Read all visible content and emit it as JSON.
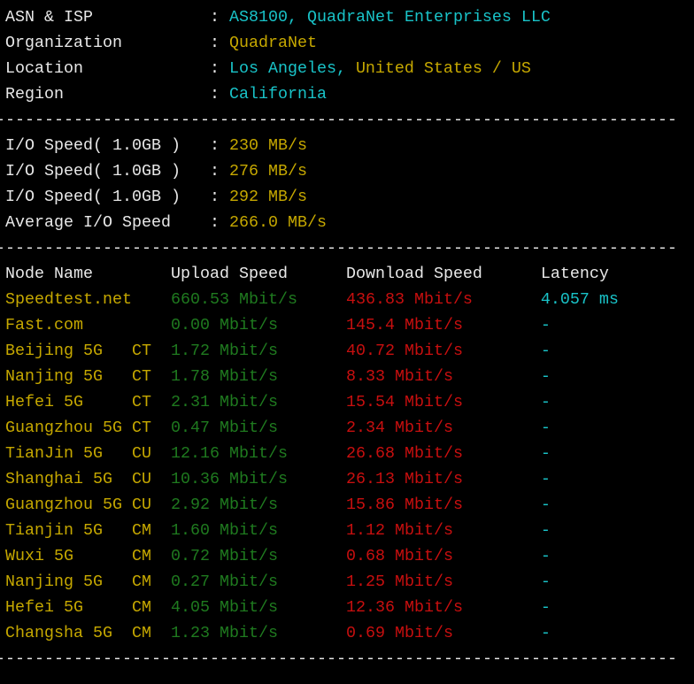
{
  "colors": {
    "white": "#e8e8e8",
    "cyan": "#19c3c8",
    "yellow": "#c6a800",
    "green": "#1f7a1f",
    "red": "#c80f0f"
  },
  "info": [
    {
      "label": "ASN & ISP",
      "value": "AS8100, QuadraNet Enterprises LLC",
      "value2": ""
    },
    {
      "label": "Organization",
      "value": "QuadraNet",
      "value2": ""
    },
    {
      "label": "Location",
      "value": "Los Angeles,",
      "value2": "United States / US"
    },
    {
      "label": "Region",
      "value": "California",
      "value2": ""
    }
  ],
  "separator": "----------------------------------------------------------------------",
  "io": [
    {
      "label": "I/O Speed( 1.0GB )",
      "value": "230 MB/s"
    },
    {
      "label": "I/O Speed( 1.0GB )",
      "value": "276 MB/s"
    },
    {
      "label": "I/O Speed( 1.0GB )",
      "value": "292 MB/s"
    },
    {
      "label": "Average I/O Speed",
      "value": "266.0 MB/s"
    }
  ],
  "speed_headers": {
    "node": "Node Name",
    "upload": "Upload Speed",
    "download": "Download Speed",
    "latency": "Latency"
  },
  "speed_rows": [
    {
      "node": "Speedtest.net",
      "isp": "",
      "upload": "660.53 Mbit/s",
      "download": "436.83 Mbit/s",
      "latency": "4.057 ms"
    },
    {
      "node": "Fast.com",
      "isp": "",
      "upload": "0.00 Mbit/s",
      "download": "145.4 Mbit/s",
      "latency": "-"
    },
    {
      "node": "Beijing 5G",
      "isp": "CT",
      "upload": "1.72 Mbit/s",
      "download": "40.72 Mbit/s",
      "latency": "-"
    },
    {
      "node": "Nanjing 5G",
      "isp": "CT",
      "upload": "1.78 Mbit/s",
      "download": "8.33 Mbit/s",
      "latency": "-"
    },
    {
      "node": "Hefei 5G",
      "isp": "CT",
      "upload": "2.31 Mbit/s",
      "download": "15.54 Mbit/s",
      "latency": "-"
    },
    {
      "node": "Guangzhou 5G",
      "isp": "CT",
      "upload": "0.47 Mbit/s",
      "download": "2.34 Mbit/s",
      "latency": "-"
    },
    {
      "node": "TianJin 5G",
      "isp": "CU",
      "upload": "12.16 Mbit/s",
      "download": "26.68 Mbit/s",
      "latency": "-"
    },
    {
      "node": "Shanghai 5G",
      "isp": "CU",
      "upload": "10.36 Mbit/s",
      "download": "26.13 Mbit/s",
      "latency": "-"
    },
    {
      "node": "Guangzhou 5G",
      "isp": "CU",
      "upload": "2.92 Mbit/s",
      "download": "15.86 Mbit/s",
      "latency": "-"
    },
    {
      "node": "Tianjin 5G",
      "isp": "CM",
      "upload": "1.60 Mbit/s",
      "download": "1.12 Mbit/s",
      "latency": "-"
    },
    {
      "node": "Wuxi 5G",
      "isp": "CM",
      "upload": "0.72 Mbit/s",
      "download": "0.68 Mbit/s",
      "latency": "-"
    },
    {
      "node": "Nanjing 5G",
      "isp": "CM",
      "upload": "0.27 Mbit/s",
      "download": "1.25 Mbit/s",
      "latency": "-"
    },
    {
      "node": "Hefei 5G",
      "isp": "CM",
      "upload": "4.05 Mbit/s",
      "download": "12.36 Mbit/s",
      "latency": "-"
    },
    {
      "node": "Changsha 5G",
      "isp": "CM",
      "upload": "1.23 Mbit/s",
      "download": "0.69 Mbit/s",
      "latency": "-"
    }
  ]
}
